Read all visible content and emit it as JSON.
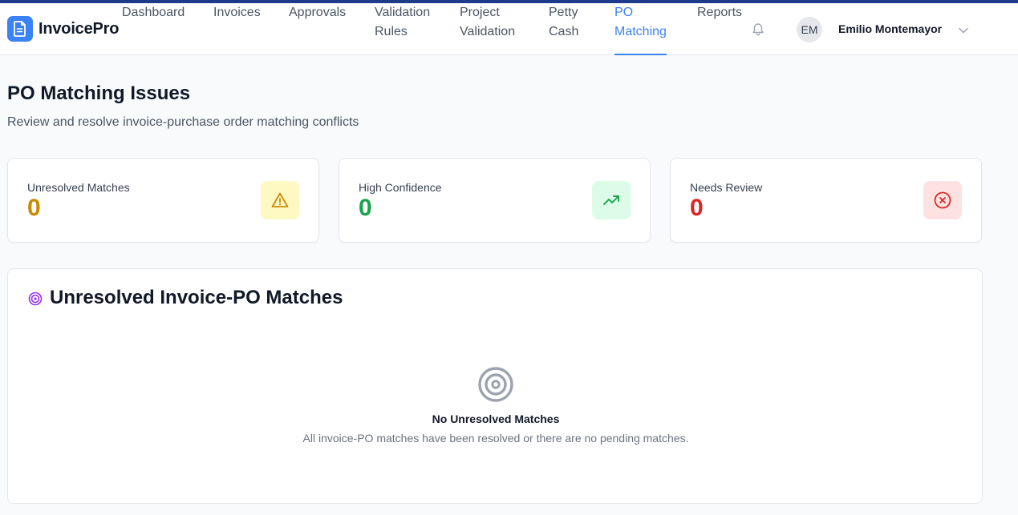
{
  "app": {
    "name": "InvoicePro"
  },
  "nav": {
    "items": [
      {
        "line1": "Dashboard",
        "line2": ""
      },
      {
        "line1": "Invoices",
        "line2": ""
      },
      {
        "line1": "Approvals",
        "line2": ""
      },
      {
        "line1": "Validation",
        "line2": "Rules"
      },
      {
        "line1": "Project",
        "line2": "Validation"
      },
      {
        "line1": "Petty",
        "line2": "Cash"
      },
      {
        "line1": "PO",
        "line2": "Matching"
      },
      {
        "line1": "Reports",
        "line2": ""
      }
    ],
    "active_index": 6
  },
  "user": {
    "initials": "EM",
    "name": "Emilio Montemayor"
  },
  "page": {
    "title": "PO Matching Issues",
    "subtitle": "Review and resolve invoice-purchase order matching conflicts"
  },
  "stats": [
    {
      "label": "Unresolved Matches",
      "value": "0",
      "color": "#ca8a04",
      "icon": "warning-triangle-icon",
      "icon_bg": "#fef9c3"
    },
    {
      "label": "High Confidence",
      "value": "0",
      "color": "#16a34a",
      "icon": "trending-up-icon",
      "icon_bg": "#dcfce7"
    },
    {
      "label": "Needs Review",
      "value": "0",
      "color": "#dc2626",
      "icon": "x-circle-icon",
      "icon_bg": "#fee2e2"
    }
  ],
  "panel": {
    "title": "Unresolved Invoice-PO Matches",
    "empty_title": "No Unresolved Matches",
    "empty_desc": "All invoice-PO matches have been resolved or there are no pending matches."
  },
  "colors": {
    "accent": "#3b82f6",
    "brand_bar": "#1e3a8a",
    "target_purple": "#9333ea"
  }
}
